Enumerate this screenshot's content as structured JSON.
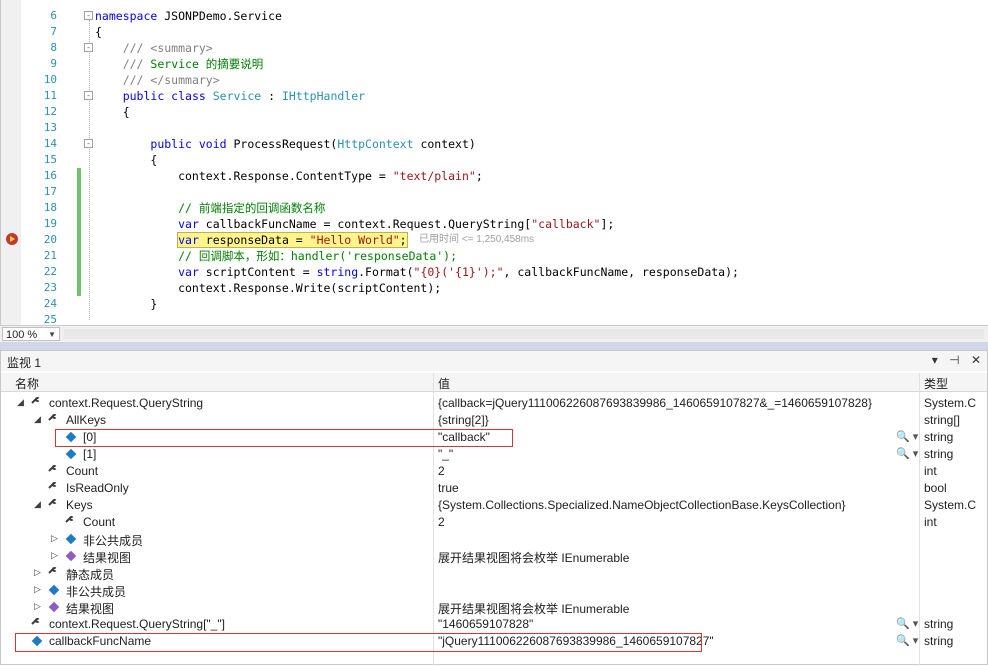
{
  "editor": {
    "lines": [
      {
        "n": "6",
        "html": "<span class='kw'>namespace</span> JSONPDemo.Service",
        "fold": "-",
        "chg": false
      },
      {
        "n": "7",
        "html": "{",
        "fold": "",
        "chg": false
      },
      {
        "n": "8",
        "html": "    <span class='dc'>/// &lt;summary&gt;</span>",
        "fold": "-",
        "chg": false
      },
      {
        "n": "9",
        "html": "    <span class='dc'>///</span> <span class='cm'>Service 的摘要说明</span>",
        "fold": "",
        "chg": false
      },
      {
        "n": "10",
        "html": "    <span class='dc'>/// &lt;/summary&gt;</span>",
        "fold": "",
        "chg": false
      },
      {
        "n": "11",
        "html": "    <span class='kw'>public class</span> <span class='ty'>Service</span> : <span class='ty'>IHttpHandler</span>",
        "fold": "-",
        "chg": false
      },
      {
        "n": "12",
        "html": "    {",
        "fold": "",
        "chg": false
      },
      {
        "n": "13",
        "html": "",
        "fold": "",
        "chg": false
      },
      {
        "n": "14",
        "html": "        <span class='kw'>public void</span> ProcessRequest(<span class='ty'>HttpContext</span> context)",
        "fold": "-",
        "chg": false
      },
      {
        "n": "15",
        "html": "        {",
        "fold": "",
        "chg": false
      },
      {
        "n": "16",
        "html": "            context.Response.ContentType = <span class='st'>\"text/plain\"</span>;",
        "fold": "",
        "chg": true
      },
      {
        "n": "17",
        "html": "",
        "fold": "",
        "chg": true
      },
      {
        "n": "18",
        "html": "            <span class='cm'>// 前端指定的回调函数名称</span>",
        "fold": "",
        "chg": true
      },
      {
        "n": "19",
        "html": "            <span class='kw'>var</span> callbackFuncName = context.Request.QueryString[<span class='st'>\"callback\"</span>];",
        "fold": "",
        "chg": true
      },
      {
        "n": "20",
        "html": "            <span class='cur'><span class='kw'>var</span> responseData = <span class='st'>\"Hello World\"</span>;</span>",
        "fold": "",
        "chg": true
      },
      {
        "n": "21",
        "html": "            <span class='cm'>// 回调脚本，形如：handler('responseData');</span>",
        "fold": "",
        "chg": true
      },
      {
        "n": "22",
        "html": "            <span class='kw'>var</span> scriptContent = <span class='kw'>string</span>.Format(<span class='st'>\"{0}('{1}');\"</span>, callbackFuncName, responseData);",
        "fold": "",
        "chg": true
      },
      {
        "n": "23",
        "html": "            context.Response.Write(scriptContent);",
        "fold": "",
        "chg": true
      },
      {
        "n": "24",
        "html": "        }",
        "fold": "",
        "chg": false
      },
      {
        "n": "25",
        "html": "",
        "fold": "",
        "chg": false
      }
    ],
    "perf_tip": "已用时间 <= 1,250,458ms",
    "zoom_level": "100 %"
  },
  "watch": {
    "title": "监视 1",
    "icons": {
      "dropdown": "▾",
      "pin": "📌",
      "close": "✕"
    },
    "columns": {
      "name": "名称",
      "value": "值",
      "type": "类型"
    },
    "rows": [
      {
        "depth": 0,
        "tri": "◢",
        "icon": "wrench",
        "name": "context.Request.QueryString",
        "value": "{callback=jQuery111006226087693839986_1460659107827&_=1460659107828}",
        "type": "System.C",
        "mag": false
      },
      {
        "depth": 1,
        "tri": "◢",
        "icon": "wrench",
        "name": "AllKeys",
        "value": "{string[2]}",
        "type": "string[]",
        "mag": false
      },
      {
        "depth": 2,
        "tri": "",
        "icon": "cube",
        "name": "[0]",
        "value": "\"callback\"",
        "type": "string",
        "mag": true
      },
      {
        "depth": 2,
        "tri": "",
        "icon": "cube",
        "name": "[1]",
        "value": "\"_\"",
        "type": "string",
        "mag": true
      },
      {
        "depth": 1,
        "tri": "",
        "icon": "wrench",
        "name": "Count",
        "value": "2",
        "type": "int",
        "mag": false
      },
      {
        "depth": 1,
        "tri": "",
        "icon": "wrench",
        "name": "IsReadOnly",
        "value": "true",
        "type": "bool",
        "mag": false
      },
      {
        "depth": 1,
        "tri": "◢",
        "icon": "wrench",
        "name": "Keys",
        "value": "{System.Collections.Specialized.NameObjectCollectionBase.KeysCollection}",
        "type": "System.C",
        "mag": false
      },
      {
        "depth": 2,
        "tri": "",
        "icon": "wrench",
        "name": "Count",
        "value": "2",
        "type": "int",
        "mag": false
      },
      {
        "depth": 2,
        "tri": "▷",
        "icon": "cube",
        "name": "非公共成员",
        "value": "",
        "type": "",
        "mag": false
      },
      {
        "depth": 2,
        "tri": "▷",
        "icon": "cube-p",
        "name": "结果视图",
        "value": "展开结果视图将会枚举 IEnumerable",
        "type": "",
        "mag": false
      },
      {
        "depth": 1,
        "tri": "▷",
        "icon": "wrench",
        "name": "静态成员",
        "value": "",
        "type": "",
        "mag": false
      },
      {
        "depth": 1,
        "tri": "▷",
        "icon": "cube",
        "name": "非公共成员",
        "value": "",
        "type": "",
        "mag": false
      },
      {
        "depth": 1,
        "tri": "▷",
        "icon": "cube-p",
        "name": "结果视图",
        "value": "展开结果视图将会枚举 IEnumerable",
        "type": "",
        "mag": false
      },
      {
        "depth": 0,
        "tri": "",
        "icon": "wrench",
        "name": "context.Request.QueryString[\"_\"]",
        "value": "\"1460659107828\"",
        "type": "string",
        "mag": true
      },
      {
        "depth": 0,
        "tri": "",
        "icon": "cube",
        "name": "callbackFuncName",
        "value": "\"jQuery111006226087693839986_1460659107827\"",
        "type": "string",
        "mag": true
      }
    ],
    "mag_glyph": "🔍 ▾"
  }
}
